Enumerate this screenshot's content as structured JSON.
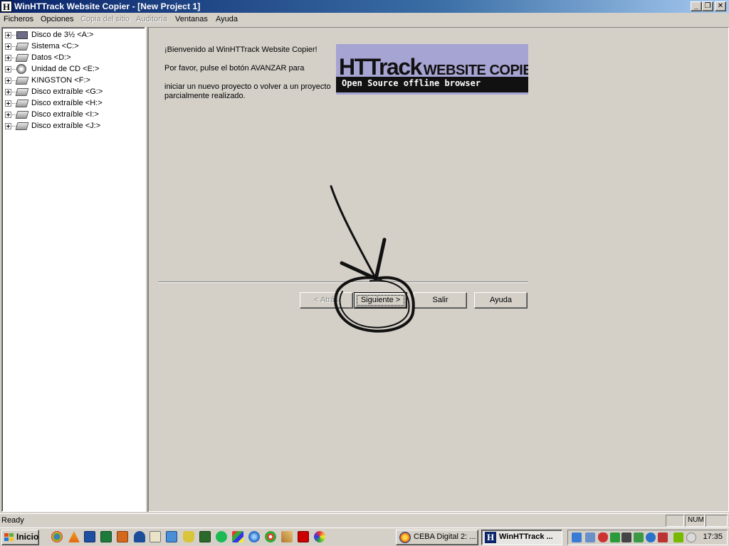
{
  "window": {
    "title": "WinHTTrack Website Copier - [New Project 1]",
    "controls": {
      "minimize": "_",
      "maximize": "❐",
      "close": "✕"
    }
  },
  "menu": {
    "items": [
      {
        "label": "Ficheros",
        "enabled": true
      },
      {
        "label": "Opciones",
        "enabled": true
      },
      {
        "label": "Copia del sitio",
        "enabled": false
      },
      {
        "label": "Auditoría",
        "enabled": false
      },
      {
        "label": "Ventanas",
        "enabled": true
      },
      {
        "label": "Ayuda",
        "enabled": true
      }
    ]
  },
  "tree": {
    "items": [
      {
        "label": "Disco de 3½ <A:>",
        "icon": "floppy-drive-icon"
      },
      {
        "label": "Sistema <C:>",
        "icon": "hard-drive-icon"
      },
      {
        "label": "Datos <D:>",
        "icon": "hard-drive-icon"
      },
      {
        "label": "Unidad de CD <E:>",
        "icon": "cd-drive-icon"
      },
      {
        "label": "KINGSTON <F:>",
        "icon": "removable-drive-icon"
      },
      {
        "label": "Disco extraíble <G:>",
        "icon": "removable-drive-icon"
      },
      {
        "label": "Disco extraíble <H:>",
        "icon": "removable-drive-icon"
      },
      {
        "label": "Disco extraíble <I:>",
        "icon": "removable-drive-icon"
      },
      {
        "label": "Disco extraíble <J:>",
        "icon": "removable-drive-icon"
      }
    ]
  },
  "welcome": {
    "line1": "¡Bienvenido al WinHTTrack Website Copier!",
    "line2": "Por favor, pulse el botón AVANZAR para",
    "line3": "iniciar un nuevo proyecto o volver a un proyecto",
    "line4": "parcialmente realizado."
  },
  "logo": {
    "brand_big": "HTTrack",
    "brand_small": "WEBSITE COPIER",
    "tagline": "Open Source offline browser"
  },
  "wizard": {
    "back_label": "< Atrás",
    "next_label": "Siguiente >",
    "exit_label": "Salir",
    "help_label": "Ayuda"
  },
  "status": {
    "text": "Ready",
    "num_indicator": "NUM"
  },
  "taskbar": {
    "start_label": "Inicio",
    "tasks": [
      {
        "label": "CEBA Digital 2: ...",
        "active": false
      },
      {
        "label": "WinHTTrack ...",
        "active": true
      }
    ],
    "clock": "17:35"
  }
}
